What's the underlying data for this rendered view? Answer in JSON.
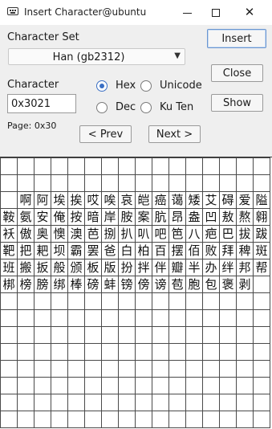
{
  "window": {
    "title": "Insert Character@ubuntu",
    "minimize_icon": "minimize-icon",
    "maximize_icon": "maximize-icon",
    "close_icon": "close-icon"
  },
  "character_set": {
    "label": "Character Set",
    "selected": "Han (gb2312)"
  },
  "character": {
    "label": "Character",
    "value": "0x3021"
  },
  "page_info": "Page: 0x30",
  "radios": {
    "hex": {
      "label": "Hex",
      "checked": true
    },
    "unicode": {
      "label": "Unicode",
      "checked": false
    },
    "dec": {
      "label": "Dec",
      "checked": false
    },
    "kuten": {
      "label": "Ku Ten",
      "checked": false
    }
  },
  "buttons": {
    "insert": "Insert",
    "close": "Close",
    "show": "Show",
    "prev": "< Prev",
    "next": "Next >"
  },
  "grid_rows": [
    [
      "",
      "",
      "",
      "",
      "",
      "",
      "",
      "",
      "",
      "",
      "",
      "",
      "",
      "",
      "",
      ""
    ],
    [
      "",
      "",
      "",
      "",
      "",
      "",
      "",
      "",
      "",
      "",
      "",
      "",
      "",
      "",
      "",
      ""
    ],
    [
      "",
      "啊",
      "阿",
      "埃",
      "挨",
      "哎",
      "唉",
      "哀",
      "皑",
      "癌",
      "蔼",
      "矮",
      "艾",
      "碍",
      "爱",
      "隘"
    ],
    [
      "鞍",
      "氨",
      "安",
      "俺",
      "按",
      "暗",
      "岸",
      "胺",
      "案",
      "肮",
      "昂",
      "盎",
      "凹",
      "敖",
      "熬",
      "翱"
    ],
    [
      "袄",
      "傲",
      "奥",
      "懊",
      "澳",
      "芭",
      "捌",
      "扒",
      "叭",
      "吧",
      "笆",
      "八",
      "疤",
      "巴",
      "拔",
      "跋"
    ],
    [
      "靶",
      "把",
      "耙",
      "坝",
      "霸",
      "罢",
      "爸",
      "白",
      "柏",
      "百",
      "摆",
      "佰",
      "败",
      "拜",
      "稗",
      "斑"
    ],
    [
      "班",
      "搬",
      "扳",
      "般",
      "颁",
      "板",
      "版",
      "扮",
      "拌",
      "伴",
      "瓣",
      "半",
      "办",
      "绊",
      "邦",
      "帮"
    ],
    [
      "梆",
      "榜",
      "膀",
      "绑",
      "棒",
      "磅",
      "蚌",
      "镑",
      "傍",
      "谤",
      "苞",
      "胞",
      "包",
      "褒",
      "剥",
      ""
    ],
    [
      "",
      "",
      "",
      "",
      "",
      "",
      "",
      "",
      "",
      "",
      "",
      "",
      "",
      "",
      "",
      ""
    ],
    [
      "",
      "",
      "",
      "",
      "",
      "",
      "",
      "",
      "",
      "",
      "",
      "",
      "",
      "",
      "",
      ""
    ],
    [
      "",
      "",
      "",
      "",
      "",
      "",
      "",
      "",
      "",
      "",
      "",
      "",
      "",
      "",
      "",
      ""
    ],
    [
      "",
      "",
      "",
      "",
      "",
      "",
      "",
      "",
      "",
      "",
      "",
      "",
      "",
      "",
      "",
      ""
    ],
    [
      "",
      "",
      "",
      "",
      "",
      "",
      "",
      "",
      "",
      "",
      "",
      "",
      "",
      "",
      "",
      ""
    ],
    [
      "",
      "",
      "",
      "",
      "",
      "",
      "",
      "",
      "",
      "",
      "",
      "",
      "",
      "",
      "",
      ""
    ],
    [
      "",
      "",
      "",
      "",
      "",
      "",
      "",
      "",
      "",
      "",
      "",
      "",
      "",
      "",
      "",
      ""
    ],
    [
      "",
      "",
      "",
      "",
      "",
      "",
      "",
      "",
      "",
      "",
      "",
      "",
      "",
      "",
      "",
      ""
    ]
  ]
}
